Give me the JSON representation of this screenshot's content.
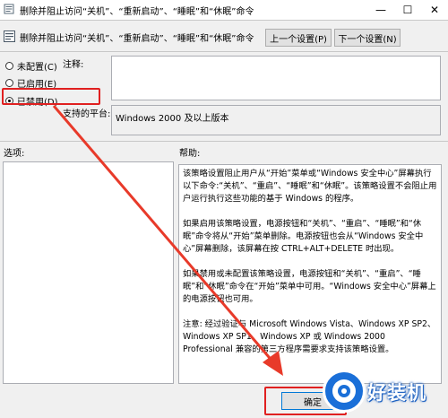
{
  "window": {
    "title": "删除并阻止访问“关机”、“重新启动”、“睡眠”和“休眠”命令",
    "minimize": "—",
    "maximize": "☐",
    "close": "✕"
  },
  "header": {
    "policy_title": "删除并阻止访问“关机”、“重新启动”、“睡眠”和“休眠”命令",
    "prev_button": "上一个设置(P)",
    "next_button": "下一个设置(N)"
  },
  "options": {
    "not_configured": "未配置(C)",
    "enabled": "已启用(E)",
    "disabled": "已禁用(D)",
    "selected": "disabled"
  },
  "comment": {
    "label": "注释:",
    "value": ""
  },
  "supported": {
    "label": "支持的平台:",
    "value": "Windows 2000 及以上版本"
  },
  "sections": {
    "options_label": "选项:",
    "help_label": "帮助:"
  },
  "help": {
    "p1": "该策略设置阻止用户从“开始”菜单或“Windows 安全中心”屏幕执行以下命令:“关机”、“重启”、“睡眠”和“休眠”。该策略设置不会阻止用户运行执行这些功能的基于 Windows 的程序。",
    "p2": "如果启用该策略设置，电源按钮和“关机”、“重启”、“睡眠”和“休眠”命令将从“开始”菜单删除。电源按钮也会从“Windows 安全中心”屏幕删除，该屏幕在按 CTRL+ALT+DELETE 时出现。",
    "p3": "如果禁用或未配置该策略设置，电源按钮和“关机”、“重启”、“睡眠”和“休眠”命令在“开始”菜单中可用。“Windows 安全中心”屏幕上的电源按钮也可用。",
    "p4": "注意: 经过验证与 Microsoft Windows Vista、Windows XP SP2、Windows XP SP1、Windows XP 或 Windows 2000 Professional 兼容的第三方程序需要求支持该策略设置。"
  },
  "footer": {
    "ok_button": "确定"
  },
  "watermark": {
    "text": "好装机"
  },
  "colors": {
    "highlight": "#e02020",
    "arrow": "#e83a2a",
    "watermark": "#1a6fd8"
  }
}
